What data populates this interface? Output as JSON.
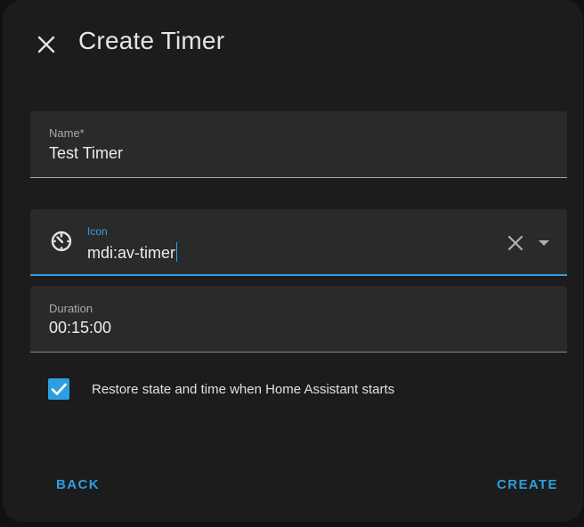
{
  "dialog": {
    "title": "Create Timer"
  },
  "fields": {
    "name": {
      "label": "Name*",
      "value": "Test Timer"
    },
    "icon": {
      "label": "Icon",
      "value": "mdi:av-timer"
    },
    "duration": {
      "label": "Duration",
      "value": "00:15:00"
    }
  },
  "restore": {
    "checked": true,
    "label": "Restore state and time when Home Assistant starts"
  },
  "actions": {
    "back_label": "BACK",
    "create_label": "CREATE"
  },
  "colors": {
    "accent": "#2d9fe0",
    "surface": "#1c1c1c",
    "field": "#2a2a2a"
  },
  "icons": {
    "close": "close-icon",
    "timer": "av-timer-icon",
    "clear": "clear-icon",
    "dropdown": "menu-down-icon",
    "check": "check-icon"
  }
}
